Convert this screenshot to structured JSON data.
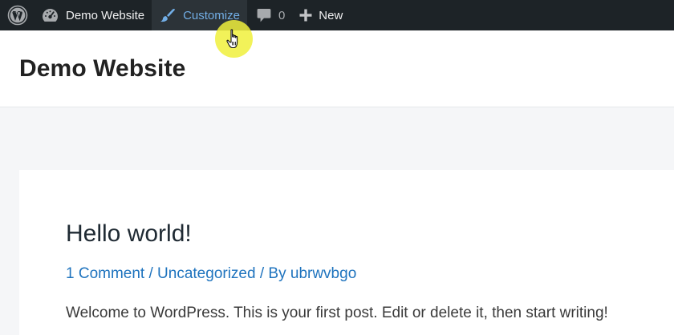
{
  "adminbar": {
    "wp_logo_icon": "wordpress-logo-icon",
    "site_icon": "dashboard-gauge-icon",
    "site_name": "Demo Website",
    "customize_icon": "paintbrush-icon",
    "customize_label": "Customize",
    "comments_icon": "comment-bubble-icon",
    "comments_count": "0",
    "new_icon": "plus-icon",
    "new_label": "New"
  },
  "header": {
    "site_title": "Demo Website"
  },
  "post": {
    "title": "Hello world!",
    "meta": {
      "comments_link": "1 Comment",
      "sep1": " / ",
      "category_link": "Uncategorized",
      "sep2": " / By ",
      "author_link": "ubrwvbgo"
    },
    "excerpt": "Welcome to WordPress. This is your first post. Edit or delete it, then start writing!"
  },
  "colors": {
    "adminbar_bg": "#1d2327",
    "adminbar_hover_bg": "#2c3338",
    "adminbar_hover_text": "#72aee6",
    "link": "#1e73be",
    "cursor_highlight": "#f0f03c"
  }
}
